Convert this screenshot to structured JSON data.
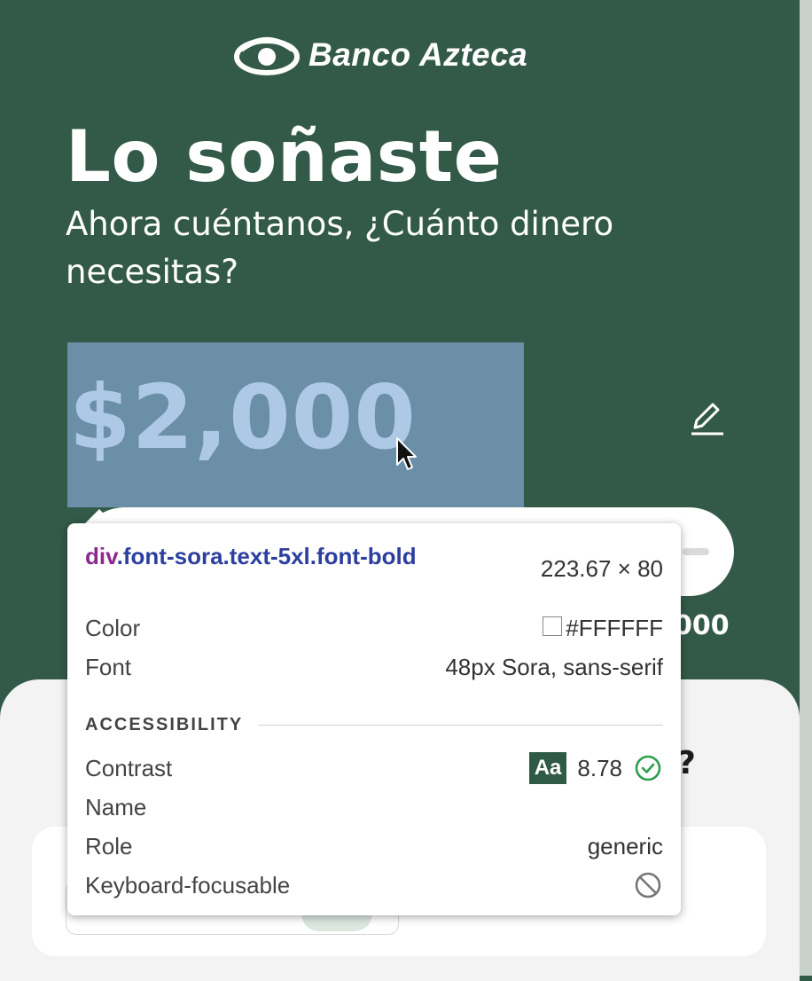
{
  "logo": {
    "text": "Banco Azteca"
  },
  "hero": {
    "title": "Lo soñaste",
    "subtitle": "Ahora cuéntanos, ¿Cuánto dinero necesitas?"
  },
  "amount": {
    "value": "$2,000"
  },
  "slider": {
    "max_label_partial": "000"
  },
  "sheet": {
    "question_partial": "?"
  },
  "inspector": {
    "selector_tag": "div",
    "selector_classes": ".font-sora.text-5xl.font-bold",
    "size": "223.67 × 80",
    "color_label": "Color",
    "color_value": "#FFFFFF",
    "font_label": "Font",
    "font_value": "48px Sora, sans-serif",
    "section_title": "ACCESSIBILITY",
    "contrast_label": "Contrast",
    "contrast_badge": "Aa",
    "contrast_value": "8.78",
    "name_label": "Name",
    "name_value": "",
    "role_label": "Role",
    "role_value": "generic",
    "focusable_label": "Keyboard-focusable"
  },
  "colors": {
    "brand_green": "#335a49",
    "highlight_blue": "#6a8fa7",
    "amount_text": "#aec9e6",
    "contrast_ok": "#2e9e4f"
  },
  "icons": {
    "logo": "banco-azteca-eye-logo",
    "edit": "pencil-icon",
    "cursor": "mouse-pointer-icon",
    "contrast_status": "check-circle-icon",
    "focusable_status": "not-allowed-icon"
  }
}
